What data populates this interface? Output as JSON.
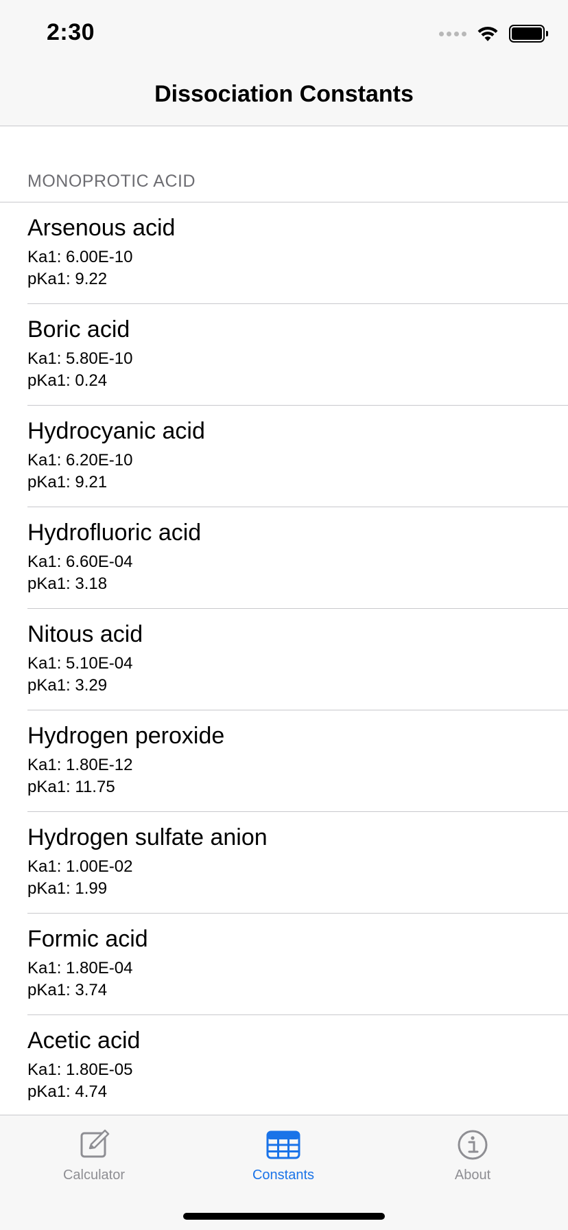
{
  "status_bar": {
    "time": "2:30"
  },
  "nav": {
    "title": "Dissociation Constants"
  },
  "section": {
    "header": "MONOPROTIC ACID"
  },
  "acids": [
    {
      "name": "Arsenous acid",
      "ka": "Ka1: 6.00E-10",
      "pka": "pKa1: 9.22"
    },
    {
      "name": "Boric acid",
      "ka": "Ka1: 5.80E-10",
      "pka": "pKa1: 0.24"
    },
    {
      "name": "Hydrocyanic acid",
      "ka": "Ka1: 6.20E-10",
      "pka": "pKa1: 9.21"
    },
    {
      "name": "Hydrofluoric acid",
      "ka": "Ka1: 6.60E-04",
      "pka": "pKa1: 3.18"
    },
    {
      "name": "Nitous acid",
      "ka": "Ka1: 5.10E-04",
      "pka": "pKa1: 3.29"
    },
    {
      "name": "Hydrogen peroxide",
      "ka": "Ka1: 1.80E-12",
      "pka": "pKa1: 11.75"
    },
    {
      "name": "Hydrogen sulfate anion",
      "ka": "Ka1: 1.00E-02",
      "pka": "pKa1: 1.99"
    },
    {
      "name": "Formic acid",
      "ka": "Ka1: 1.80E-04",
      "pka": "pKa1: 3.74"
    },
    {
      "name": "Acetic acid",
      "ka": "Ka1: 1.80E-05",
      "pka": "pKa1: 4.74"
    }
  ],
  "tabs": [
    {
      "label": "Calculator",
      "icon": "edit-icon",
      "active": false
    },
    {
      "label": "Constants",
      "icon": "table-icon",
      "active": true
    },
    {
      "label": "About",
      "icon": "info-icon",
      "active": false
    }
  ],
  "colors": {
    "accent": "#1a73e8",
    "inactive_tab": "#8e8e93",
    "section_header": "#6d6d72",
    "separator": "#c8c8cc",
    "bar_background": "#f7f7f7"
  }
}
